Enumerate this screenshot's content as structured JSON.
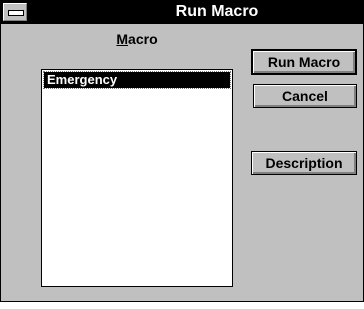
{
  "window": {
    "title": "Run Macro"
  },
  "macro_list": {
    "label_mnemonic": "M",
    "label_rest": "acro",
    "items": [
      "Emergency"
    ],
    "selected_index": 0
  },
  "buttons": {
    "run_macro": "Run Macro",
    "cancel": "Cancel",
    "description": "Description"
  },
  "icons": {
    "system_menu": "system-menu-icon"
  }
}
